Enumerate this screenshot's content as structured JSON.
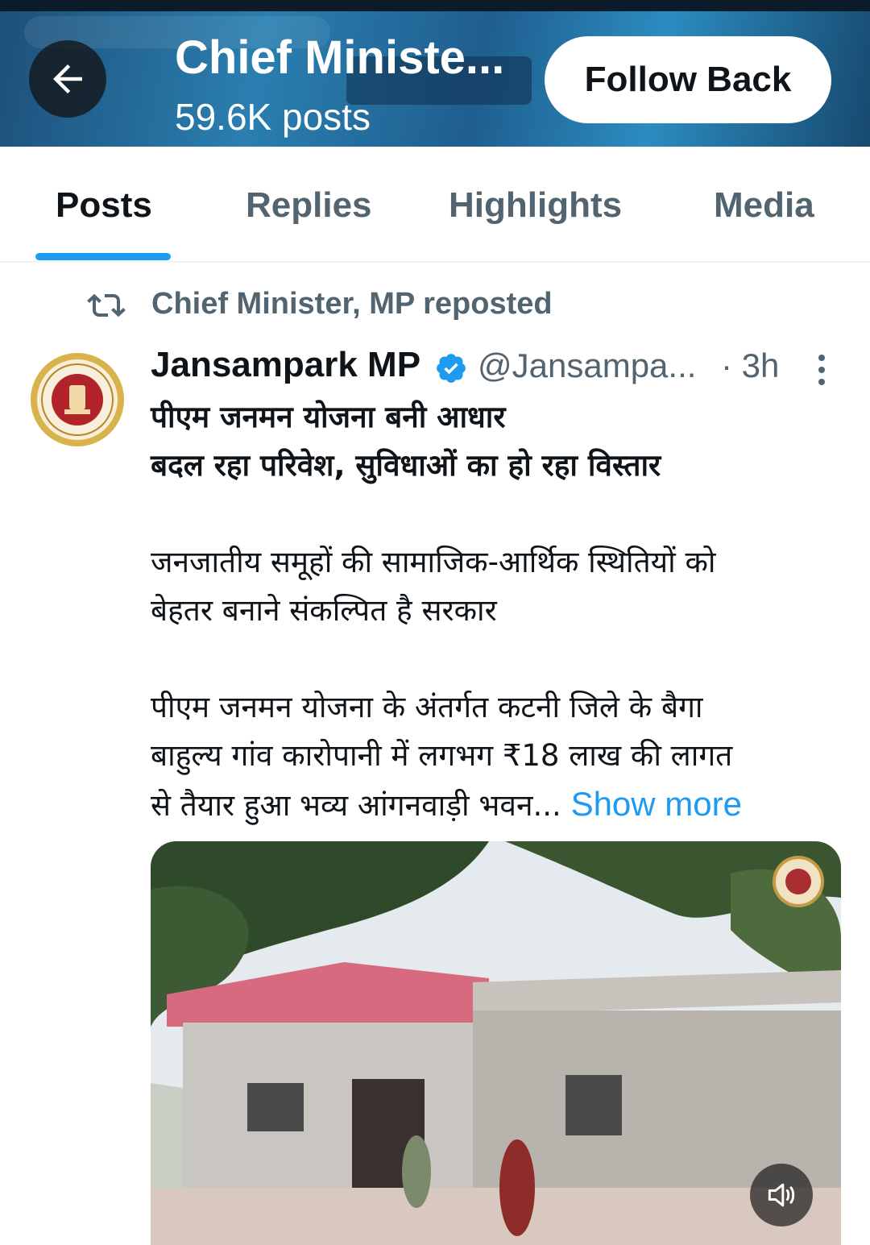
{
  "header": {
    "title": "Chief Ministe...",
    "post_count": "59.6K posts",
    "follow_label": "Follow Back",
    "back_icon": "arrow-left-icon"
  },
  "tabs": [
    {
      "label": "Posts",
      "active": true
    },
    {
      "label": "Replies",
      "active": false
    },
    {
      "label": "Highlights",
      "active": false
    },
    {
      "label": "Media",
      "active": false
    }
  ],
  "post": {
    "repost_label": "Chief Minister, MP reposted",
    "author": {
      "name": "Jansampark MP",
      "handle": "@Jansampa...",
      "verified": true
    },
    "time": "· 3h",
    "headline_line1": "पीएम जनमन योजना बनी आधार",
    "headline_line2": "बदल रहा परिवेश, सुविधाओं का हो रहा विस्तार",
    "para1_line1": "जनजातीय समूहों की सामाजिक-आर्थिक स्थितियों को",
    "para1_line2": "बेहतर बनाने संकल्पित है सरकार",
    "para2_line1": "पीएम जनमन योजना के अंतर्गत कटनी जिले के बैगा",
    "para2_line2": "बाहुल्य गांव कारोपानी में लगभग ₹18 लाख की लागत",
    "para2_line3": "से तैयार हुआ भव्य आंगनवाड़ी भवन...",
    "show_more": "Show more"
  },
  "colors": {
    "accent": "#1d9bf0",
    "secondary_text": "#536471",
    "primary_text": "#0f1419"
  }
}
